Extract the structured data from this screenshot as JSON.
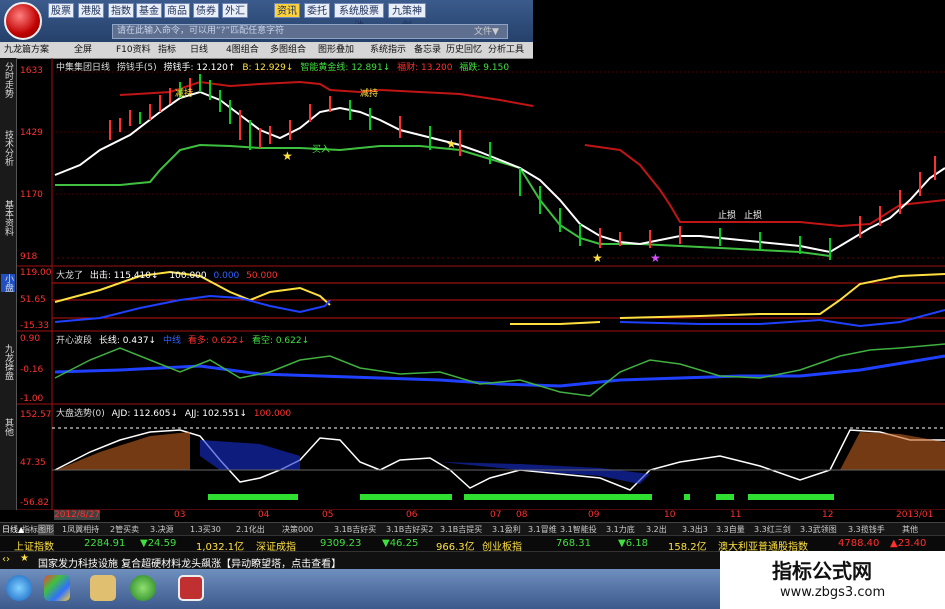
{
  "toolbar": {
    "buttons": [
      "股票",
      "港股",
      "指数",
      "基金",
      "商品",
      "债券",
      "外汇",
      "资讯",
      "委托",
      "系统股票池",
      "九策神剑"
    ],
    "search_placeholder": "请在此输入命令，可以用“?”匹配任意字符",
    "file_menu": "文件▼"
  },
  "toolbar2": {
    "items": [
      "九龙篇方案",
      "全屏",
      "F10资料",
      "指标",
      "日线",
      "4图组合",
      "多图组合",
      "图形叠加",
      "系统指示",
      "备忘录",
      "历史回忆",
      "分析工具"
    ]
  },
  "side_tabs": [
    "分时走势",
    "技术分析",
    "基本资料",
    "小盘",
    "九龙操盘",
    "其他"
  ],
  "panel1": {
    "title": "中集集团日线",
    "indicator": "捞钱手(5)",
    "readouts": [
      "捞钱手: 12.120↑",
      "B: 12.929↓",
      "智能黄金线: 12.891↓",
      "福财: 13.200",
      "福跌: 9.150"
    ],
    "y_labels": [
      "1633",
      "1429",
      "1170",
      "918"
    ],
    "annotations": [
      "减持",
      "减持",
      "买入",
      "止损",
      "止损"
    ]
  },
  "panel2": {
    "title": "大龙了",
    "readouts": [
      "出击: 115.410↓",
      "100.000",
      "0.000",
      "50.000"
    ],
    "y_labels": [
      "119.00",
      "51.65",
      "-15.33"
    ]
  },
  "panel3": {
    "title": "开心波段",
    "readouts": [
      "长线: 0.437↓",
      "中线",
      "看多: 0.622↓",
      "看空: 0.622↓"
    ],
    "y_labels": [
      "0.90",
      "-0.16",
      "-1.00"
    ]
  },
  "panel4": {
    "title": "大盘选势(0)",
    "readouts": [
      "AJD: 112.605↓",
      "AJJ: 102.551↓",
      "100.000"
    ],
    "y_labels": [
      "152.57",
      "47.35",
      "-56.82"
    ]
  },
  "date_bar": {
    "left": "2012/8/27",
    "labels": [
      "03",
      "04",
      "05",
      "06",
      "07",
      "08",
      "09",
      "10",
      "11",
      "12"
    ],
    "right": "2013/01"
  },
  "formula_tabs": [
    "日线▲",
    "指标",
    "图形",
    "1凤翼相持",
    "2管买卖",
    "3.决源",
    "1.3买30",
    "2.1化出",
    "决策000",
    "3.1B吉好买",
    "3.1B吉好买2",
    "3.1B吉提买",
    "3.1盈利",
    "3.1冒维",
    "3.1智能投",
    "3.1力底",
    "3.2出",
    "3.3出3",
    "3.3自量",
    "3.3红三剑",
    "3.3武领图",
    "3.3揽钱手",
    "其他"
  ],
  "index_bar": {
    "sh_name": "上证指数",
    "sh_value": "2284.91",
    "sh_change": "▼24.59",
    "sh_amount": "1,032.1亿",
    "sz_name": "深证成指",
    "sz_value": "9309.23",
    "sz_change": "▼46.25",
    "sz_amount": "966.3亿",
    "cy_name": "创业板指",
    "cy_value": "768.31",
    "cy_change": "▼6.18",
    "cy_amount": "158.2亿",
    "au_name": "澳大利亚普通股指数",
    "au_value": "4788.40",
    "au_change": "▲23.40"
  },
  "news": "国家发力科技设施 复合超硬材料龙头飙涨【异动瞭望塔，点击查看】",
  "watermark": {
    "title": "指标公式网",
    "url": "www.zbgs3.com"
  },
  "colors": {
    "up": "#ff3030",
    "down": "#00d020",
    "price_line": "#ffffff",
    "support": "#40c040",
    "resistance": "#d01818",
    "yellow": "#ffe040",
    "blue": "#2040ff"
  }
}
